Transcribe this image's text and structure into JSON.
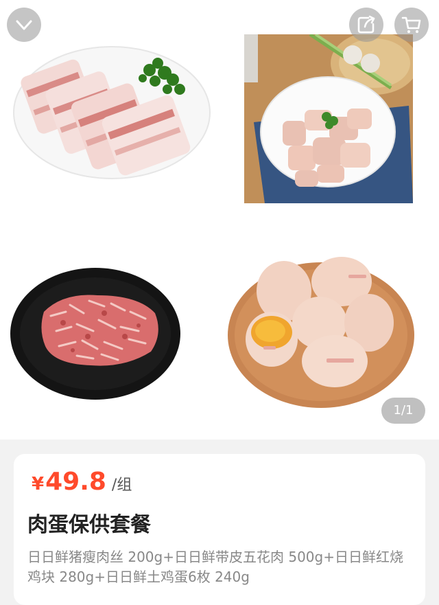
{
  "gallery": {
    "page_indicator": "1/1",
    "images": [
      {
        "name": "pork-belly-image"
      },
      {
        "name": "braised-chicken-image"
      },
      {
        "name": "lean-pork-shreds-image"
      },
      {
        "name": "farm-eggs-image"
      }
    ]
  },
  "actions": {
    "back_icon": "chevron-down-icon",
    "share_icon": "share-icon",
    "cart_icon": "cart-icon"
  },
  "product": {
    "currency": "¥",
    "price": "49.8",
    "unit": "/组",
    "title": "肉蛋保供套餐",
    "description": "日日鲜猪瘦肉丝 200g+日日鲜带皮五花肉 500g+日日鲜红烧鸡块 280g+日日鲜土鸡蛋6枚 240g"
  },
  "colors": {
    "price": "#ff4a2b",
    "page_bg": "#f2f2f2"
  }
}
